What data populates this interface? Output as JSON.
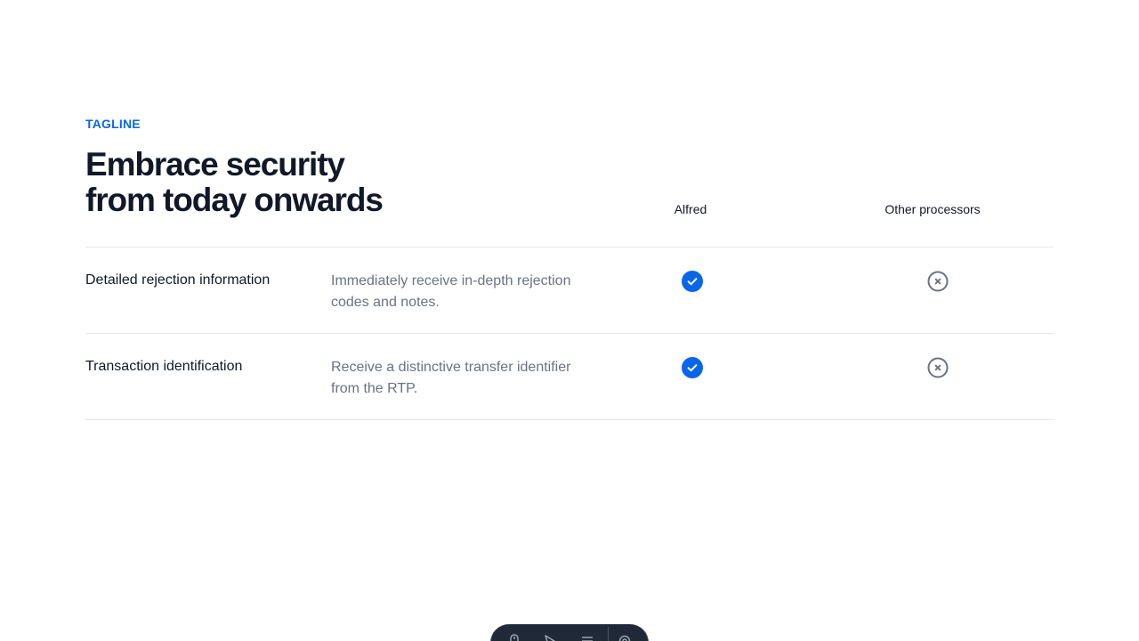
{
  "section": {
    "tagline": "TAGLINE",
    "headline_line1": "Embrace security",
    "headline_line2": "from today onwards"
  },
  "table": {
    "columns": [
      "Alfred",
      "Other processors"
    ],
    "rows": [
      {
        "feature": "Detailed rejection information",
        "description": "Immediately receive in-depth rejection codes and notes.",
        "alfred": "check-icon",
        "other": "x-circle-icon"
      },
      {
        "feature": "Transaction identification",
        "description": "Receive a distinctive transfer identifier from the RTP.",
        "alfred": "check-icon",
        "other": "x-circle-icon"
      }
    ]
  },
  "colors": {
    "accent": "#0a66e8",
    "heading": "#111827",
    "muted": "#6b7280",
    "divider": "#e5e7eb",
    "negative_icon": "#6b7280"
  },
  "dock": {
    "icons": [
      "mouse-icon",
      "cursor-icon",
      "menu-icon",
      "settings-icon"
    ]
  }
}
